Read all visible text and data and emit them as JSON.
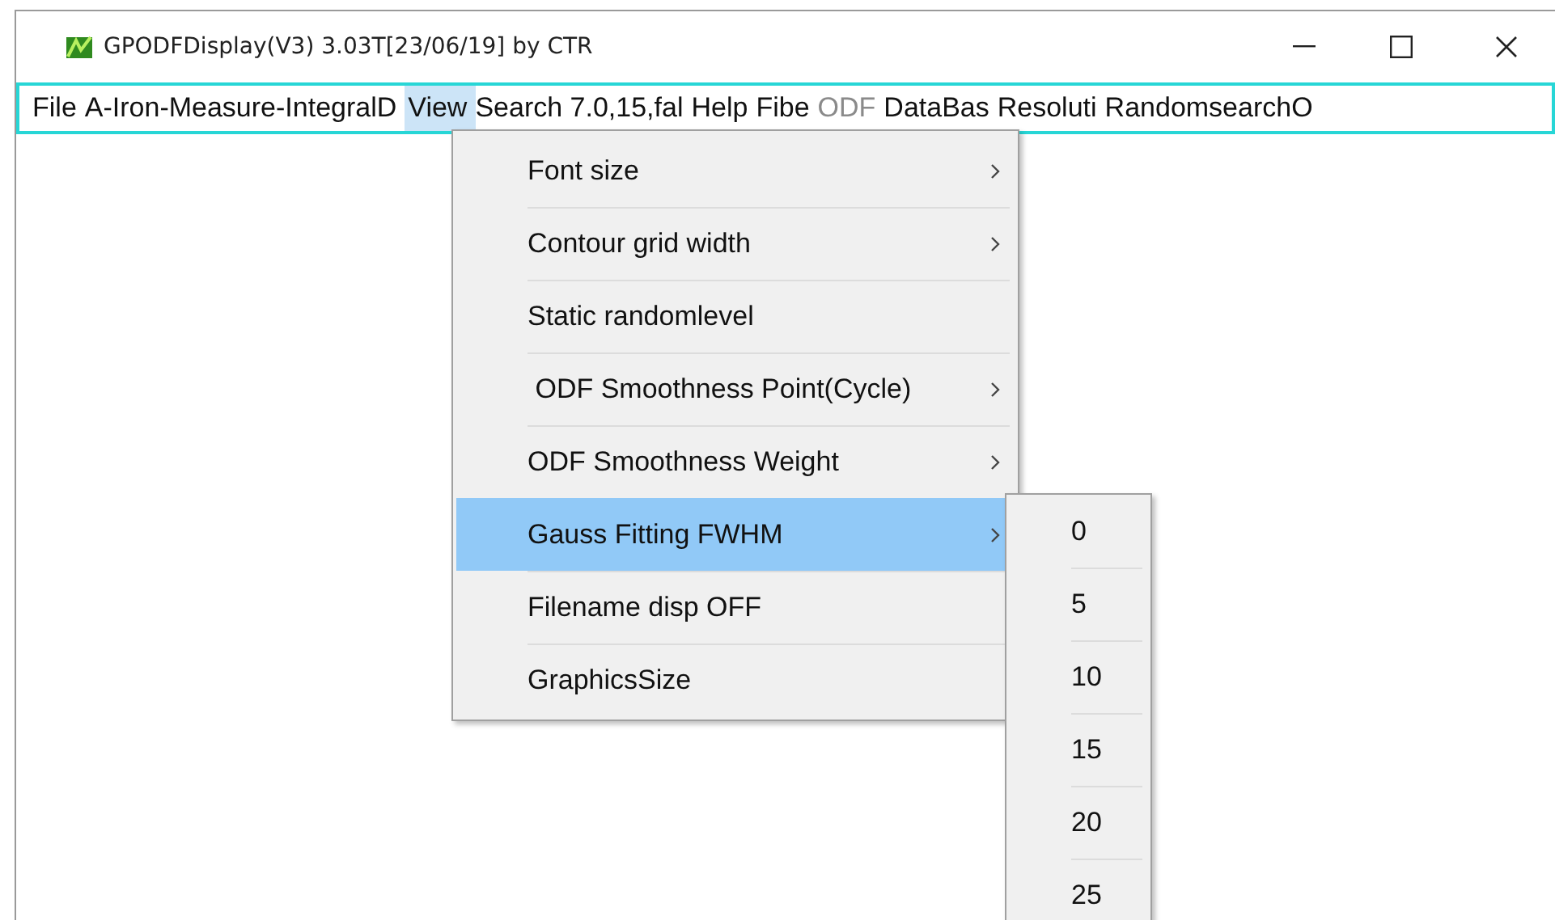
{
  "window": {
    "title": "GPODFDisplay(V3) 3.03T[23/06/19] by CTR"
  },
  "menu_bar": [
    {
      "label": "File",
      "selected": false,
      "disabled": false
    },
    {
      "label": "A-Iron-Measure-IntegralD",
      "selected": false,
      "disabled": false
    },
    {
      "label": "View",
      "selected": true,
      "disabled": false
    },
    {
      "label": "Search 7.0,15,fal",
      "selected": false,
      "disabled": false
    },
    {
      "label": "Help",
      "selected": false,
      "disabled": false
    },
    {
      "label": "Fibe",
      "selected": false,
      "disabled": false
    },
    {
      "label": "ODF",
      "selected": false,
      "disabled": true
    },
    {
      "label": "DataBas",
      "selected": false,
      "disabled": false
    },
    {
      "label": "Resoluti",
      "selected": false,
      "disabled": false
    },
    {
      "label": "RandomsearchO",
      "selected": false,
      "disabled": false
    }
  ],
  "view_menu": [
    {
      "label": "Font size",
      "kind": "submenu",
      "selected": false
    },
    {
      "label": "Contour grid width",
      "kind": "submenu",
      "selected": false
    },
    {
      "label": "Static randomlevel",
      "kind": "plain",
      "selected": false
    },
    {
      "label": " ODF Smoothness Point(Cycle)",
      "kind": "submenu",
      "selected": false
    },
    {
      "label": "ODF Smoothness Weight",
      "kind": "submenu",
      "selected": false
    },
    {
      "label": "Gauss Fitting FWHM",
      "kind": "submenu",
      "selected": true
    },
    {
      "label": "Filename disp OFF",
      "kind": "plain",
      "selected": false
    },
    {
      "label": "GraphicsSize",
      "kind": "plain",
      "selected": false
    }
  ],
  "fwhm_submenu": [
    {
      "label": "0",
      "selected": false
    },
    {
      "label": "5",
      "selected": false
    },
    {
      "label": "10",
      "selected": false
    },
    {
      "label": "15",
      "selected": false
    },
    {
      "label": "20",
      "selected": false
    },
    {
      "label": "25",
      "selected": false
    }
  ]
}
